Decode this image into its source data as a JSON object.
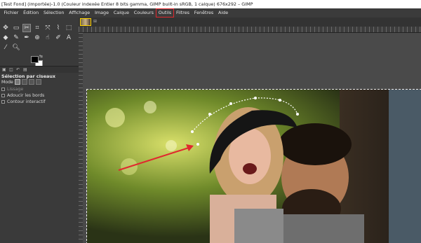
{
  "window": {
    "title": "[Test Fond] (importée)-1.0 (Couleur indexée Entier 8 bits gamma, GIMP built-in sRGB, 1 calque) 676x292 – GIMP"
  },
  "menubar": {
    "items": [
      "Fichier",
      "Édition",
      "Sélection",
      "Affichage",
      "Image",
      "Calque",
      "Couleurs",
      "Outils",
      "Filtres",
      "Fenêtres",
      "Aide"
    ],
    "highlighted": "Outils"
  },
  "tool_options": {
    "title": "Sélection par ciseaux",
    "mode_label": "Mode",
    "checks": [
      {
        "label": "Lissage",
        "dim": true
      },
      {
        "label": "Adoucir les bords",
        "dim": false
      },
      {
        "label": "Contour interactif",
        "dim": false
      }
    ]
  },
  "colors": {
    "foreground": "#000000",
    "background": "#ffffff",
    "highlight_box": "#e0282e",
    "arrow": "#e0282e"
  },
  "icons": {
    "tools_row1": [
      "move-tool-icon",
      "rect-select-icon",
      "scissors-select-icon",
      "crop-icon",
      "unified-transform-icon",
      "warp-icon",
      "cage-transform-icon"
    ],
    "tools_row2": [
      "bucket-fill-icon",
      "brush-icon",
      "ink-icon",
      "clone-icon",
      "smudge-icon",
      "path-icon",
      "text-icon"
    ],
    "tools_row3": [
      "color-picker-icon",
      "zoom-icon"
    ]
  }
}
